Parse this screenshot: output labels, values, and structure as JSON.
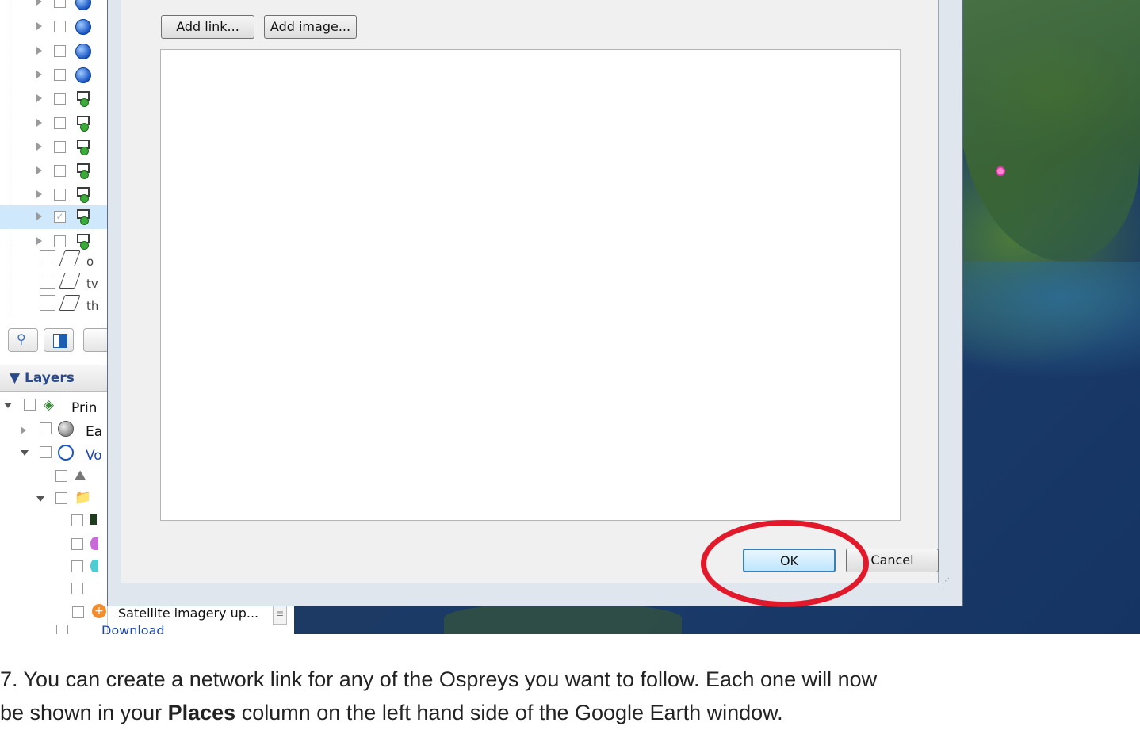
{
  "dialog": {
    "add_link_label": "Add link...",
    "add_image_label": "Add image...",
    "description_value": "",
    "ok_label": "OK",
    "cancel_label": "Cancel"
  },
  "sidebar": {
    "clipped_labels": [
      "o",
      "tv",
      "th"
    ],
    "layers_title": "▼ Layers",
    "layer_items": [
      {
        "label": "Prin",
        "icon": "layers-icon"
      },
      {
        "label": "Ea",
        "icon": "earth-icon"
      },
      {
        "label": "Vo",
        "icon": "globe-icon"
      }
    ],
    "satellite_label": "Satellite imagery up...",
    "download_label": "Download"
  },
  "caption": {
    "line1": "7. You can create a network link for any of the Ospreys you want to follow. Each one will now",
    "line2_prefix": "be shown in your ",
    "line2_bold": "Places",
    "line2_suffix": " column on the left hand side of the Google Earth window."
  },
  "colors": {
    "highlight_circle": "#e1192a",
    "ok_border": "#3c7fb1",
    "layers_title": "#2b4a8c"
  }
}
